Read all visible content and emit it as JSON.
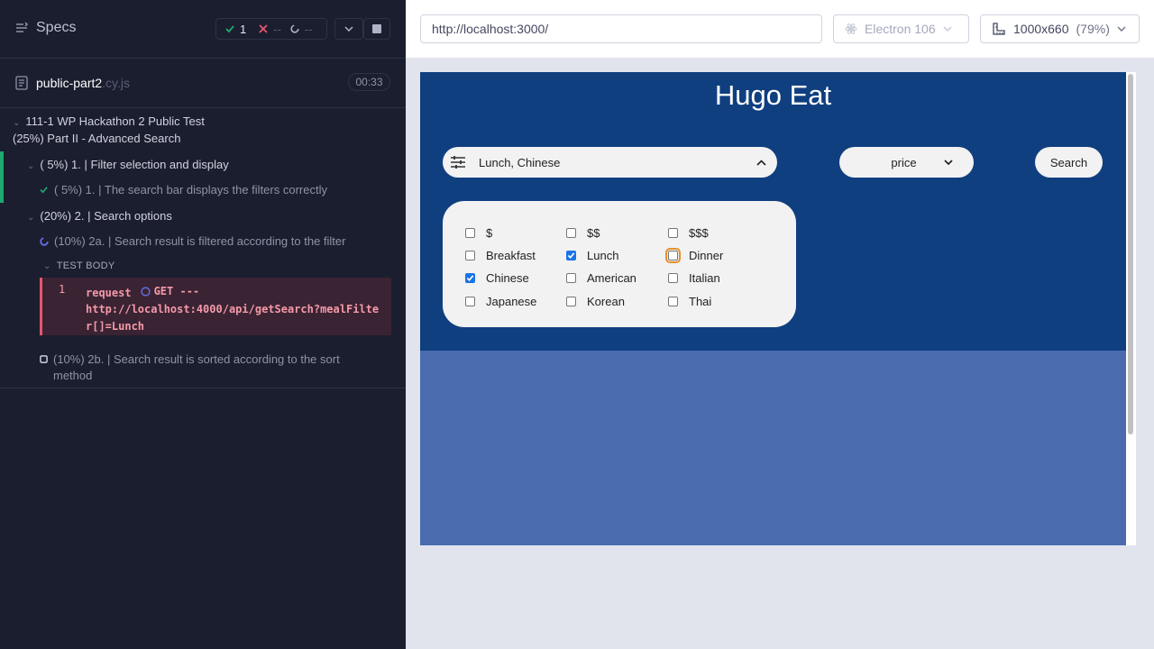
{
  "sidebar": {
    "specs_label": "Specs",
    "stats": {
      "passed": "1",
      "failed": "--",
      "pending": "--"
    },
    "file": {
      "name": "public-part2",
      "ext": ".cy.js",
      "duration": "00:33"
    },
    "suite": {
      "title": "111-1 WP Hackathon 2 Public Test",
      "subtitle": "(25%) Part II - Advanced Search",
      "sections": [
        {
          "label": "( 5%) 1. | Filter selection and display",
          "tests": [
            {
              "label": "( 5%) 1. | The search bar displays the filters correctly",
              "state": "passed"
            }
          ]
        },
        {
          "label": "(20%) 2. | Search options",
          "tests": [
            {
              "label": "(10%) 2a. | Search result is filtered according to the filter",
              "state": "running"
            },
            {
              "label": "(10%) 2b. | Search result is sorted according to the sort method",
              "state": "pending"
            }
          ]
        }
      ]
    },
    "test_body_label": "TEST BODY",
    "command": {
      "num": "1",
      "name": "request",
      "method": "GET ---",
      "url": "http://localhost:4000/api/getSearch?mealFilter[]=Lunch"
    }
  },
  "browser_bar": {
    "url": "http://localhost:3000/",
    "browser": "Electron 106",
    "viewport": "1000x660",
    "zoom": "(79%)"
  },
  "app": {
    "title": "Hugo Eat",
    "filter_value": "Lunch, Chinese",
    "sort_value": "price",
    "search_label": "Search",
    "checkboxes": [
      {
        "label": "$",
        "checked": false
      },
      {
        "label": "$$",
        "checked": false
      },
      {
        "label": "$$$",
        "checked": false
      },
      {
        "label": "Breakfast",
        "checked": false
      },
      {
        "label": "Lunch",
        "checked": true
      },
      {
        "label": "Dinner",
        "checked": false
      },
      {
        "label": "Chinese",
        "checked": true
      },
      {
        "label": "American",
        "checked": false
      },
      {
        "label": "Italian",
        "checked": false
      },
      {
        "label": "Japanese",
        "checked": false
      },
      {
        "label": "Korean",
        "checked": false
      },
      {
        "label": "Thai",
        "checked": false
      }
    ]
  },
  "colors": {
    "sidebar_bg": "#1b1e2e",
    "pass_green": "#1fa971",
    "fail_red": "#e45770",
    "app_header": "#103f80",
    "app_body": "#4a6cae",
    "checkbox_checked": "#1a73e8"
  }
}
